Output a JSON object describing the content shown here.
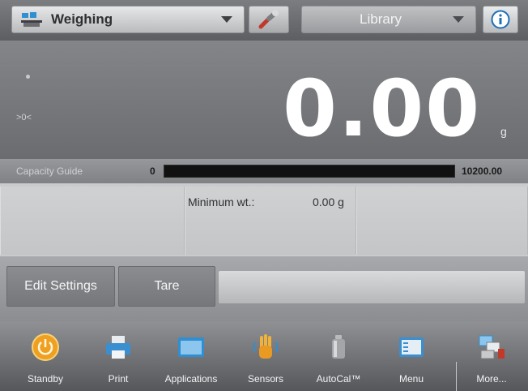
{
  "header": {
    "application": "Weighing",
    "library": "Library",
    "tools_icon": "wrench-icon",
    "info_icon": "info-icon"
  },
  "display": {
    "weight": "0.00",
    "unit": "g",
    "zero_indicator": ">0<",
    "stable_icon": "stable-dot-icon"
  },
  "capacity_guide": {
    "label": "Capacity Guide",
    "min": "0",
    "max": "10200.00",
    "fill_fraction": 0.0
  },
  "reference": {
    "min_weight_label": "Minimum wt.:",
    "min_weight_value": "0.00 g"
  },
  "actions": {
    "edit_settings": "Edit Settings",
    "tare": "Tare"
  },
  "nav": {
    "items": [
      {
        "label": "Standby",
        "icon": "standby-icon"
      },
      {
        "label": "Print",
        "icon": "printer-icon"
      },
      {
        "label": "Applications",
        "icon": "applications-icon"
      },
      {
        "label": "Sensors",
        "icon": "hand-sensor-icon"
      },
      {
        "label": "AutoCal™",
        "icon": "calibration-weight-icon"
      },
      {
        "label": "Menu",
        "icon": "menu-icon"
      },
      {
        "label": "More...",
        "icon": "more-icon"
      }
    ]
  },
  "colors": {
    "accent_blue": "#2f8fd0",
    "standby_orange": "#f0a020",
    "info_blue": "#1e6fb8"
  }
}
